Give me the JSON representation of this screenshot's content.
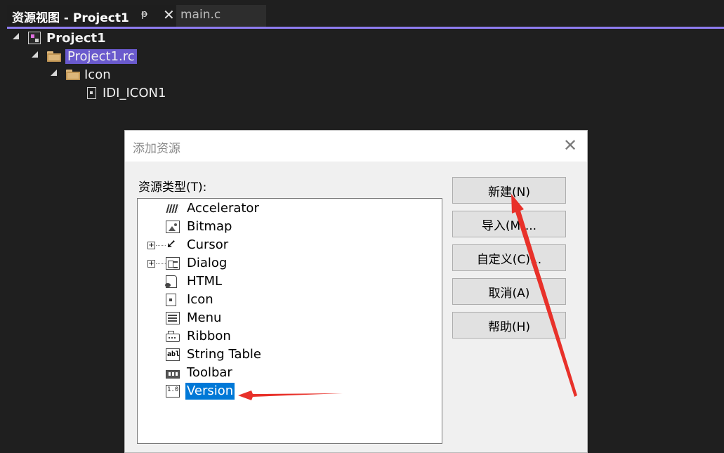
{
  "tabs": {
    "active_title": "资源视图 - Project1",
    "inactive_title": "main.c",
    "pin_glyph": "ᵽ",
    "close_glyph": "✕"
  },
  "tree": {
    "project": "Project1",
    "rc_file": "Project1.rc",
    "icon_folder": "Icon",
    "icon_item": "IDI_ICON1"
  },
  "dialog": {
    "title": "添加资源",
    "close_glyph": "✕",
    "type_label": "资源类型(T):",
    "resource_types": [
      {
        "label": "Accelerator",
        "expandable": false
      },
      {
        "label": "Bitmap",
        "expandable": false
      },
      {
        "label": "Cursor",
        "expandable": true
      },
      {
        "label": "Dialog",
        "expandable": true
      },
      {
        "label": "HTML",
        "expandable": false
      },
      {
        "label": "Icon",
        "expandable": false
      },
      {
        "label": "Menu",
        "expandable": false
      },
      {
        "label": "Ribbon",
        "expandable": false
      },
      {
        "label": "String Table",
        "expandable": false
      },
      {
        "label": "Toolbar",
        "expandable": false
      },
      {
        "label": "Version",
        "expandable": false,
        "selected": true
      }
    ],
    "expander_glyph": "+",
    "buttons": {
      "new": "新建(N)",
      "import": "导入(M)...",
      "custom": "自定义(C)...",
      "cancel": "取消(A)",
      "help": "帮助(H)"
    }
  },
  "colors": {
    "accent": "#8e7cf0",
    "selection": "#0078d7",
    "annotation_arrow": "#e8312a"
  }
}
